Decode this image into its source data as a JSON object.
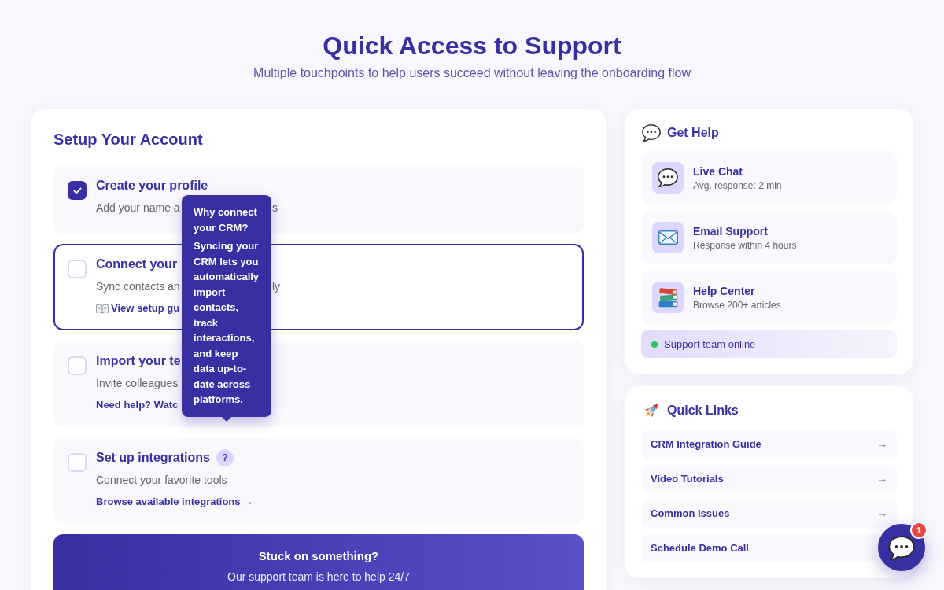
{
  "header": {
    "title": "Quick Access to Support",
    "subtitle": "Multiple touchpoints to help users succeed without leaving the onboarding flow"
  },
  "setup": {
    "title": "Setup Your Account",
    "tasks": [
      {
        "title": "Create your profile",
        "description": "Add your name a",
        "description_tail": "s",
        "checked": true,
        "highlighted": false
      },
      {
        "title": "Connect your",
        "description": "Sync contacts an",
        "description_tail": "ly",
        "link": {
          "kind": "guide",
          "text": "View setup gu"
        },
        "checked": false,
        "highlighted": true
      },
      {
        "title": "Import your te",
        "description": "Invite colleagues",
        "link": {
          "kind": "text",
          "text": "Need help? Watc"
        },
        "checked": false,
        "highlighted": false
      },
      {
        "title": "Set up integrations",
        "help": "?",
        "description": "Connect your favorite tools",
        "link": {
          "kind": "text",
          "text": "Browse available integrations →"
        },
        "checked": false,
        "highlighted": false
      }
    ],
    "tooltip": {
      "title": "Why connect your CRM?",
      "body": "Syncing your CRM lets you automatically import contacts, track interactions, and keep data up-to-date across platforms."
    },
    "banner": {
      "title": "Stuck on something?",
      "text": "Our support team is here to help 24/7"
    }
  },
  "help": {
    "title": "Get Help",
    "channels": [
      {
        "kind": "chat",
        "title": "Live Chat",
        "detail": "Avg. response: 2 min"
      },
      {
        "kind": "email",
        "title": "Email Support",
        "detail": "Response within 4 hours"
      },
      {
        "kind": "docs",
        "title": "Help Center",
        "detail": "Browse 200+ articles"
      }
    ],
    "status": {
      "text": "Support team online",
      "online": true
    }
  },
  "quick_links": {
    "title": "Quick Links",
    "links": [
      {
        "label": "CRM Integration Guide",
        "arrow": "→"
      },
      {
        "label": "Video Tutorials",
        "arrow": "→"
      },
      {
        "label": "Common Issues",
        "arrow": "→"
      },
      {
        "label": "Schedule Demo Call"
      }
    ]
  },
  "chat_button": {
    "badge": "1"
  }
}
